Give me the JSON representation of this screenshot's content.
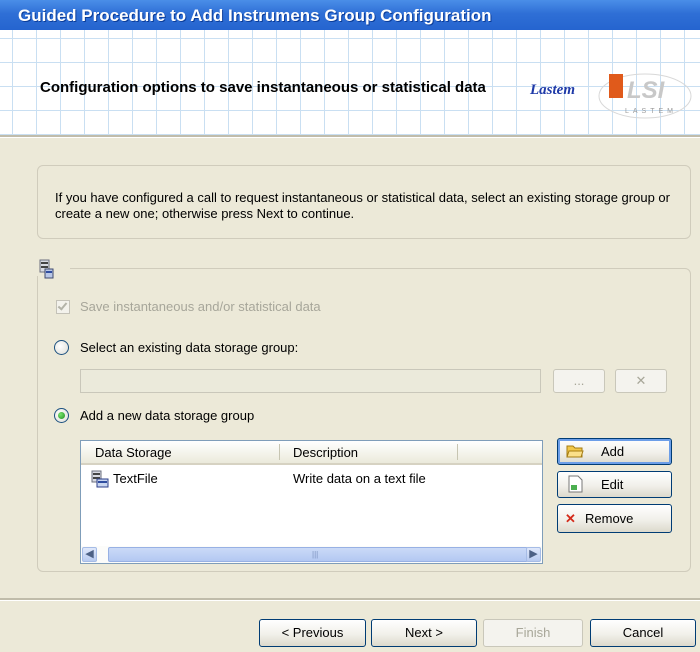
{
  "window": {
    "title": "Guided Procedure to Add Instrumens Group Configuration"
  },
  "header": {
    "title": "Configuration options to save instantaneous or statistical data",
    "logo_brand": "Lastem",
    "logo_mark": "LSI",
    "logo_sub": "LASTEM"
  },
  "info": {
    "text": "If you have configured a call to request instantaneous or statistical data, select an existing storage group or create a new one; otherwise press Next to continue."
  },
  "options": {
    "save_data_label": "Save instantaneous and/or  statistical data",
    "save_data_checked": true,
    "select_existing_label": "Select an existing data storage group:",
    "select_existing_value": "",
    "browse_button": "...",
    "clear_button": "✕",
    "add_new_label": "Add a new data storage group"
  },
  "table": {
    "columns": [
      "Data Storage",
      "Description"
    ],
    "rows": [
      {
        "storage": "TextFile",
        "description": "Write data on a text file"
      }
    ],
    "scroll_left": "◀",
    "scroll_right": "▶",
    "grip": "|||"
  },
  "actions": {
    "add": "Add",
    "edit": "Edit",
    "remove": "Remove",
    "remove_icon": "✕"
  },
  "footer": {
    "previous": "< Previous",
    "next": "Next >",
    "finish": "Finish",
    "cancel": "Cancel"
  },
  "colors": {
    "title_bar": "#2f6fd6",
    "dialog_bg": "#ece9d8",
    "accent_green": "#1f8d1f",
    "remove_red": "#d42a1a"
  }
}
